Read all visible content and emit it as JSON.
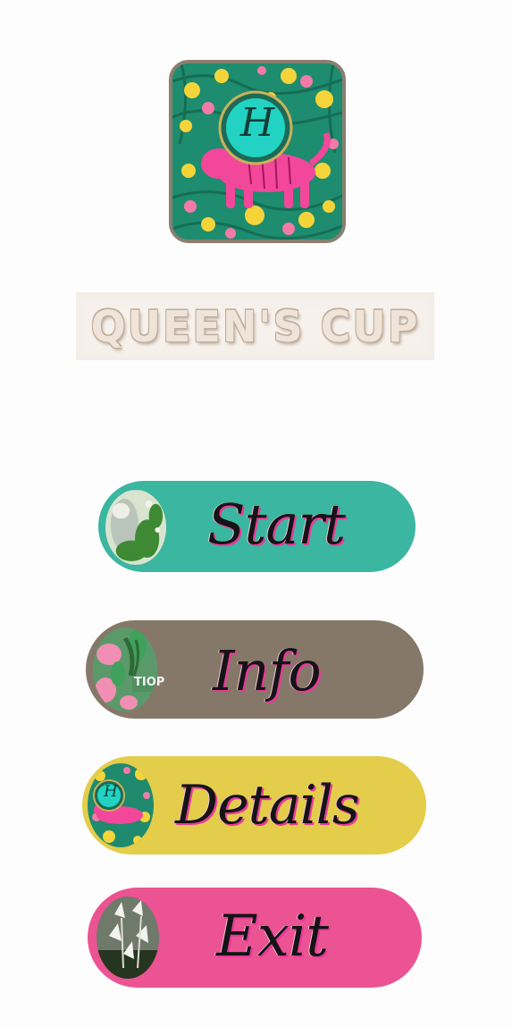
{
  "app": {
    "logo_monogram": "H",
    "title": "QUEEN'S CUP"
  },
  "menu": {
    "items": [
      {
        "id": "start",
        "label": "Start",
        "color": "#3bb6a0",
        "thumb_icon": "tiger-jungle-icon"
      },
      {
        "id": "info",
        "label": "Info",
        "color": "#857868",
        "thumb_icon": "floral-emblem-icon",
        "thumb_text": "TIOP"
      },
      {
        "id": "details",
        "label": "Details",
        "color": "#e3cd4a",
        "thumb_icon": "tiger-floral-logo-icon",
        "thumb_monogram": "H"
      },
      {
        "id": "exit",
        "label": "Exit",
        "color": "#ec5393",
        "thumb_icon": "white-lilies-icon"
      }
    ]
  },
  "colors": {
    "background": "#fdfdfd",
    "logo_teal": "#22d3c4",
    "logo_pink": "#f2479a",
    "logo_yellow": "#f4d63a",
    "logo_border": "#8a7f70"
  }
}
